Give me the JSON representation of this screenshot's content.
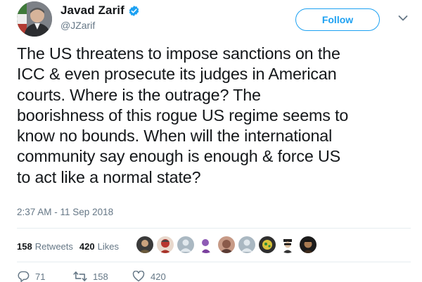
{
  "author": {
    "name": "Javad Zarif",
    "handle": "@JZarif",
    "verified": true
  },
  "follow_button": {
    "label": "Follow"
  },
  "tweet": {
    "lines": [
      "The US threatens to impose sanctions on the",
      "ICC & even prosecute its judges in American",
      "courts. Where is the outrage? The",
      "boorishness of this rogue US regime seems to",
      "know no bounds. When will the international",
      "community say enough is enough & force US",
      "to act like a normal state?"
    ],
    "timestamp": "2:37 AM - 11 Sep 2018"
  },
  "stats": {
    "retweets_count": "158",
    "retweets_label": "Retweets",
    "likes_count": "420",
    "likes_label": "Likes"
  },
  "actions": {
    "replies": "71",
    "retweets": "158",
    "likes": "420"
  },
  "colors": {
    "accent": "#1da1f2",
    "text": "#14171a",
    "secondary": "#657786",
    "divider": "#e6ecf0"
  },
  "liked_by_avatars": [
    "avatar-1",
    "avatar-2",
    "avatar-3",
    "avatar-4",
    "avatar-5",
    "avatar-6",
    "avatar-7",
    "avatar-8",
    "avatar-9",
    "avatar-10"
  ]
}
